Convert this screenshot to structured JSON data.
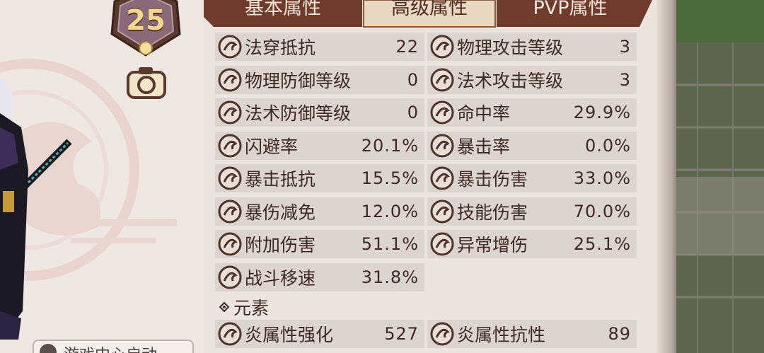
{
  "level": "25",
  "voice_button": {
    "label": "游戏中心启动"
  },
  "tabs": [
    {
      "label": "基本属性",
      "active": false
    },
    {
      "label": "高级属性",
      "active": true
    },
    {
      "label": "PVP属性",
      "active": false
    }
  ],
  "stats": [
    {
      "icon": "magic-pen-resist-icon",
      "label": "法穿抵抗",
      "value": "22"
    },
    {
      "icon": "physical-attack-level-icon",
      "label": "物理攻击等级",
      "value": "3"
    },
    {
      "icon": "physical-defense-level-icon",
      "label": "物理防御等级",
      "value": "0"
    },
    {
      "icon": "magic-attack-level-icon",
      "label": "法术攻击等级",
      "value": "3"
    },
    {
      "icon": "magic-defense-level-icon",
      "label": "法术防御等级",
      "value": "0"
    },
    {
      "icon": "hit-rate-icon",
      "label": "命中率",
      "value": "29.9%"
    },
    {
      "icon": "dodge-rate-icon",
      "label": "闪避率",
      "value": "20.1%"
    },
    {
      "icon": "crit-rate-icon",
      "label": "暴击率",
      "value": "0.0%"
    },
    {
      "icon": "crit-resist-icon",
      "label": "暴击抵抗",
      "value": "15.5%"
    },
    {
      "icon": "crit-damage-icon",
      "label": "暴击伤害",
      "value": "33.0%"
    },
    {
      "icon": "crit-damage-reduce-icon",
      "label": "暴伤减免",
      "value": "12.0%"
    },
    {
      "icon": "skill-damage-icon",
      "label": "技能伤害",
      "value": "70.0%"
    },
    {
      "icon": "extra-damage-icon",
      "label": "附加伤害",
      "value": "51.1%"
    },
    {
      "icon": "status-damage-icon",
      "label": "异常增伤",
      "value": "25.1%"
    },
    {
      "icon": "move-speed-icon",
      "label": "战斗移速",
      "value": "31.8%"
    }
  ],
  "element_section": {
    "title": "元素"
  },
  "element_stats": [
    {
      "icon": "fire-enhance-icon",
      "label": "炎属性强化",
      "value": "527"
    },
    {
      "icon": "fire-resist-icon",
      "label": "炎属性抗性",
      "value": "89"
    }
  ],
  "colors": {
    "tab_active": "#e8d7c2",
    "tab_inactive": "#6e3b2c",
    "cell_bg": "#dcd4cf",
    "text": "#3d2a24"
  }
}
